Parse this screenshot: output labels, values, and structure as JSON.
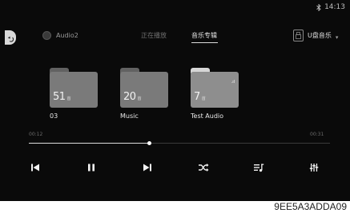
{
  "status": {
    "bluetooth_icon": "bluetooth-icon",
    "time": "14:13"
  },
  "source": {
    "label": "Audio2"
  },
  "tabs": {
    "now_playing": "正在播放",
    "albums": "音乐专辑"
  },
  "usb": {
    "label": "U盘音乐",
    "icon": "usb-drive-icon"
  },
  "albums": [
    {
      "count": "51",
      "unit": "首",
      "name": "03",
      "color": "#7a7a7a",
      "tab_color": "#626262"
    },
    {
      "count": "20",
      "unit": "首",
      "name": "Music",
      "color": "#7a7a7a",
      "tab_color": "#626262"
    },
    {
      "count": "7",
      "unit": "首",
      "name": "Test Audio",
      "color": "#8e8e8e",
      "tab_color": "#d6d6d6"
    }
  ],
  "playback": {
    "elapsed": "00:12",
    "total": "00:31",
    "progress": 0.4
  },
  "controls": [
    "previous-icon",
    "pause-icon",
    "next-icon",
    "shuffle-icon",
    "playlist-icon",
    "equalizer-icon"
  ],
  "caption": "9EE5A3ADDA09",
  "colors": {
    "background": "#0a0a0a",
    "accent": "#ffffff",
    "muted_text": "#6f6f6f"
  }
}
